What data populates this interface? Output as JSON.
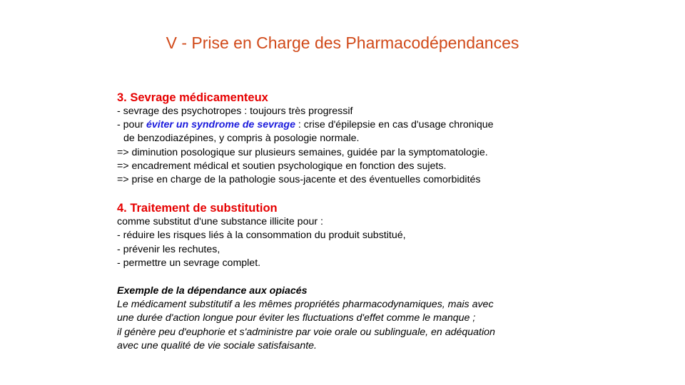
{
  "slide": {
    "title": "V - Prise en Charge des Pharmacodépendances"
  },
  "section3": {
    "heading": "3. Sevrage médicamenteux",
    "line1": "- sevrage des psychotropes : toujours  très progressif",
    "line2_prefix": "- pour ",
    "line2_highlight": "éviter un syndrome de sevrage",
    "line2_suffix": " : crise d'épilepsie en cas d'usage chronique",
    "line3": "de benzodiazépines,  y compris à posologie normale.",
    "line4": "=> diminution posologique sur plusieurs semaines, guidée par la symptomatologie.",
    "line5": "=> encadrement médical et soutien psychologique en fonction  des sujets.",
    "line6": "=> prise en charge de la pathologie sous-jacente et des éventuelles  comorbidités"
  },
  "section4": {
    "heading": "4. Traitement de substitution",
    "line1": "comme substitut d'une substance illicite pour :",
    "line2": "- réduire les risques liés à la consommation du produit substitué,",
    "line3": "- prévenir les rechutes,",
    "line4": "- permettre un sevrage complet."
  },
  "example": {
    "heading": "Exemple de la dépendance  aux opiacés",
    "line1": "Le médicament substitutif a les mêmes propriétés pharmacodynamiques, mais avec",
    "line2": "une durée d'action longue pour éviter les fluctuations d'effet comme le manque ;",
    "line3": "il génère peu d'euphorie et s'administre par voie orale ou sublinguale, en adéquation",
    "line4": "avec une qualité de vie sociale satisfaisante."
  },
  "colors": {
    "title": "#d14a1a",
    "heading": "#e60000",
    "highlight": "#1a1adc",
    "text": "#000000",
    "background": "#ffffff"
  }
}
